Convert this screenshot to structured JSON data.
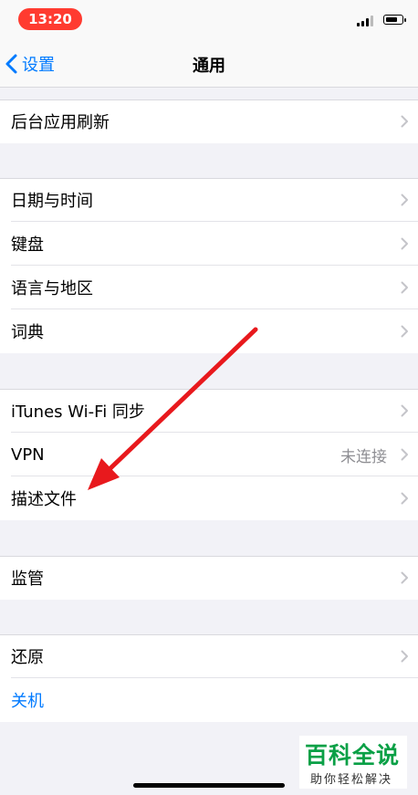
{
  "status_bar": {
    "time": "13:20",
    "time_pill_color": "#ff3b30"
  },
  "nav": {
    "back_label": "设置",
    "title": "通用",
    "accent_color": "#007aff"
  },
  "groups": [
    {
      "items": [
        {
          "label": "后台应用刷新"
        }
      ]
    },
    {
      "items": [
        {
          "label": "日期与时间"
        },
        {
          "label": "键盘"
        },
        {
          "label": "语言与地区"
        },
        {
          "label": "词典"
        }
      ]
    },
    {
      "items": [
        {
          "label": "iTunes Wi-Fi 同步"
        },
        {
          "label": "VPN",
          "value": "未连接"
        },
        {
          "label": "描述文件"
        }
      ]
    },
    {
      "items": [
        {
          "label": "监管"
        }
      ]
    },
    {
      "items": [
        {
          "label": "还原"
        },
        {
          "label": "关机"
        }
      ]
    }
  ],
  "annotation": {
    "arrow_color": "#e8191d"
  },
  "watermark": {
    "title": "百科全说",
    "subtitle": "助你轻松解决",
    "color": "#0aa046"
  }
}
